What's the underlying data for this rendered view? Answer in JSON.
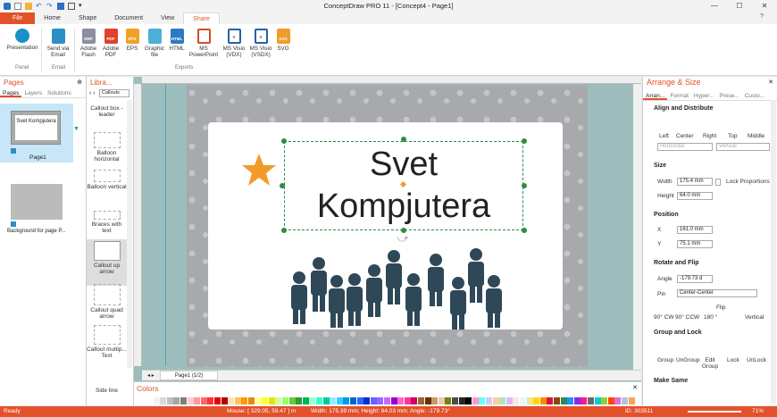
{
  "window": {
    "title": "ConceptDraw PRO 11 - [Concept4 - Page1]"
  },
  "tabs": {
    "file": "File",
    "home": "Home",
    "shape": "Shape",
    "document": "Document",
    "view": "View",
    "share": "Share"
  },
  "ribbon": {
    "presentation": "Presentation",
    "send_via_email": "Send via Email",
    "adobe_flash": "Adobe Flash",
    "adobe_pdf": "Adobe PDF",
    "eps": "EPS",
    "graphic_file": "Graphic file",
    "html": "HTML",
    "ms_powerpoint": "MS PowerPoint",
    "ms_visio_vdx": "MS Visio (VDX)",
    "ms_visio_vsdx": "MS Visio (VSDX)",
    "svg": "SVG",
    "group_panel": "Panel",
    "group_email": "Email",
    "group_exports": "Exports"
  },
  "pages_panel": {
    "title": "Pages",
    "tabs": [
      "Pages",
      "Layers",
      "Solutions"
    ],
    "page1_label": "Page1",
    "bg_label": "Background for page P...",
    "thumb_text": "Svet Kompjutera"
  },
  "library_panel": {
    "title": "Libra...",
    "dropdown": "Callouts",
    "items": [
      "Callout box - leader",
      "Balloon horizontal",
      "Balloon vertical",
      "Braces with text",
      "Callout up arrow",
      "Callout quad arrow",
      "Callout multip... Text",
      "Side line"
    ]
  },
  "canvas": {
    "text_line1": "Svet",
    "text_line2": "Kompjutera",
    "page_tab": "Page1 (1/2)"
  },
  "colors_panel": {
    "title": "Colors",
    "swatches": [
      "#ffffff",
      "#f2f2f2",
      "#d9d9d9",
      "#bfbfbf",
      "#a6a6a6",
      "#7f7f7f",
      "#ffcccc",
      "#ff9999",
      "#ff6666",
      "#ff3333",
      "#e60000",
      "#b30000",
      "#ffe0b3",
      "#ffc266",
      "#ff9900",
      "#e68a00",
      "#ffff99",
      "#ffff33",
      "#e6e600",
      "#ccff99",
      "#99ff66",
      "#66cc33",
      "#339933",
      "#00b359",
      "#99ffcc",
      "#33ffcc",
      "#00cc99",
      "#99e6ff",
      "#33ccff",
      "#0099e6",
      "#0066cc",
      "#3366ff",
      "#0033cc",
      "#6666ff",
      "#9966ff",
      "#cc66ff",
      "#9900cc",
      "#ff66cc",
      "#ff3399",
      "#cc0066",
      "#996633",
      "#663300",
      "#cc9966",
      "#e6ccb3",
      "#808000",
      "#4d4d4d",
      "#262626",
      "#000000",
      "#ff99cc",
      "#66ffff",
      "#ccccff",
      "#ffcc99",
      "#b3e6b3",
      "#e6b3ff",
      "#ffe6e6",
      "#e6f7ff",
      "#f0e68c",
      "#ffd700",
      "#ff8c00",
      "#dc143c",
      "#8b4513",
      "#2e8b57",
      "#1e90ff",
      "#8a2be2",
      "#ff1493",
      "#696969",
      "#00ced1",
      "#9acd32",
      "#ff4500",
      "#da70d6",
      "#b0c4de",
      "#f4a460"
    ]
  },
  "arrange_panel": {
    "title": "Arrange & Size",
    "tabs": [
      "Arran...",
      "Format",
      "Hyper...",
      "Prese...",
      "Custo..."
    ],
    "align_title": "Align and Distribute",
    "align_buttons": [
      "Left",
      "Center",
      "Right",
      "Top",
      "Middle"
    ],
    "distribute": [
      "Horizontal",
      "Vertical"
    ],
    "size_title": "Size",
    "width_label": "Width",
    "width_value": "175.4 mm",
    "height_label": "Height",
    "height_value": "64.0 mm",
    "lock_proportions": "Lock Proportions",
    "position_title": "Position",
    "x_label": "X",
    "x_value": "161.0 mm",
    "y_label": "Y",
    "y_value": "75.1 mm",
    "rotate_title": "Rotate and Flip",
    "angle_label": "Angle",
    "angle_value": "-179.73 d",
    "pin_label": "Pin",
    "pin_value": "Center-Center",
    "rotate_buttons": [
      "90° CW",
      "90° CCW",
      "180 °",
      "Flip",
      "Vertical"
    ],
    "group_title": "Group and Lock",
    "group_buttons": [
      "Group",
      "UnGroup",
      "Edit Group",
      "Lock",
      "UnLock"
    ],
    "make_same_title": "Make Same"
  },
  "status": {
    "ready": "Ready",
    "mouse": "Mouse: [ 329.05, 59.47 ] m",
    "size": "Width: 175.39 mm; Height: 64.03 mm; Angle: -179.73°",
    "id": "ID: 303511",
    "zoom": "71%"
  },
  "colors": {
    "accent": "#e3512a",
    "figure": "#2f4858",
    "star": "#f29b2b",
    "handle": "#2d8e3c"
  }
}
